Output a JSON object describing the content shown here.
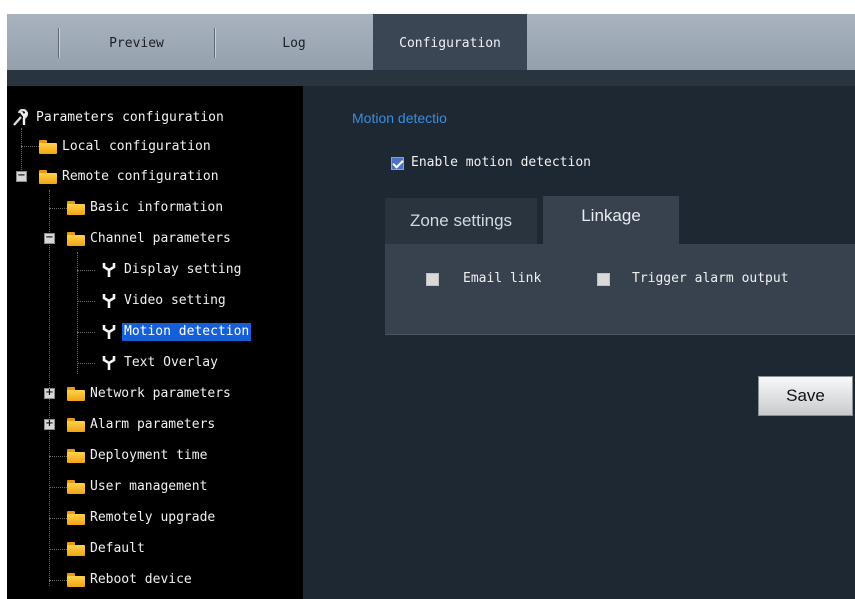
{
  "nav": {
    "tabs": [
      {
        "label": "Preview"
      },
      {
        "label": "Log"
      },
      {
        "label": "Configuration"
      }
    ]
  },
  "tree": {
    "root": "Parameters configuration",
    "local": "Local configuration",
    "remote": "Remote configuration",
    "basic": "Basic information",
    "channel": "Channel parameters",
    "display": "Display setting",
    "video": "Video setting",
    "motion": "Motion detection",
    "overlay": "Text Overlay",
    "network": "Network parameters",
    "alarm": "Alarm parameters",
    "deployment": "Deployment time",
    "user": "User management",
    "upgrade": "Remotely upgrade",
    "default": "Default",
    "reboot": "Reboot device"
  },
  "main": {
    "title": "Motion detectio",
    "enable_label": "Enable motion detection",
    "enable_checked": true,
    "subtabs": [
      "Zone settings",
      "Linkage"
    ],
    "email_label": "Email link",
    "email_checked": false,
    "trigger_label": "Trigger alarm output",
    "trigger_checked": false,
    "save_label": "Save"
  }
}
